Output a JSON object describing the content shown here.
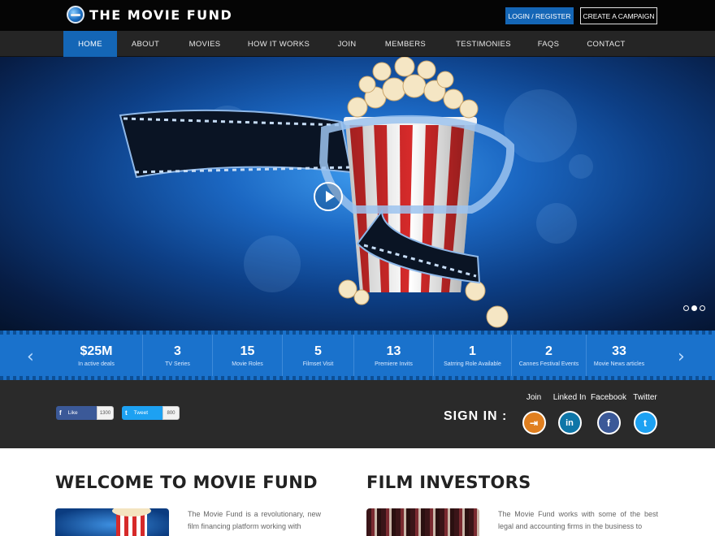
{
  "header": {
    "logo_text": "THE MOVIE FUND",
    "login_label": "LOGIN / REGISTER",
    "campaign_label": "CREATE A CAMPAIGN"
  },
  "nav": {
    "items": [
      {
        "label": "HOME",
        "active": true
      },
      {
        "label": "ABOUT",
        "active": false
      },
      {
        "label": "MOVIES",
        "active": false
      },
      {
        "label": "HOW IT WORKS",
        "active": false
      },
      {
        "label": "JOIN",
        "active": false
      },
      {
        "label": "MEMBERS",
        "active": false
      },
      {
        "label": "TESTIMONIES",
        "active": false
      },
      {
        "label": "FAQS",
        "active": false
      },
      {
        "label": "CONTACT",
        "active": false
      }
    ]
  },
  "hero": {
    "slides_total": 3,
    "active_slide": 2
  },
  "stats": {
    "prev_glyph": "‹",
    "next_glyph": "›",
    "items": [
      {
        "value": "$25M",
        "label": "In active deals"
      },
      {
        "value": "3",
        "label": "TV Series"
      },
      {
        "value": "15",
        "label": "Movie Roles"
      },
      {
        "value": "5",
        "label": "Filmset Visit"
      },
      {
        "value": "13",
        "label": "Premiere Invits"
      },
      {
        "value": "1",
        "label": "Satrring Role Available"
      },
      {
        "value": "2",
        "label": "Cannes Festival Events"
      },
      {
        "value": "33",
        "label": "Movie News articles"
      }
    ]
  },
  "share": {
    "like_label": "Like",
    "like_count": "1300",
    "tweet_label": "Tweet",
    "tweet_count": "800",
    "like_icon": "f",
    "tweet_icon": "t"
  },
  "signin": {
    "label": "SIGN IN :",
    "options": [
      {
        "caption": "Join",
        "icon": "join-icon",
        "glyph": "⇥"
      },
      {
        "caption": "Linked In",
        "icon": "linkedin-icon",
        "glyph": "in"
      },
      {
        "caption": "Facebook",
        "icon": "facebook-icon",
        "glyph": "f"
      },
      {
        "caption": "Twitter",
        "icon": "twitter-icon",
        "glyph": "t"
      }
    ]
  },
  "welcome": {
    "title": "WELCOME TO MOVIE FUND",
    "text": "The Movie Fund is a revolutionary, new film financing platform working with"
  },
  "investors": {
    "title": "FILM INVESTORS",
    "text": "The Movie Fund works with some of the best legal and accounting firms in the business to"
  },
  "colors": {
    "accent": "#1466b6",
    "stats_band": "#1a72cc",
    "top_bar": "#050505",
    "nav_bar": "#252525",
    "social_band": "#2a2a2a"
  }
}
